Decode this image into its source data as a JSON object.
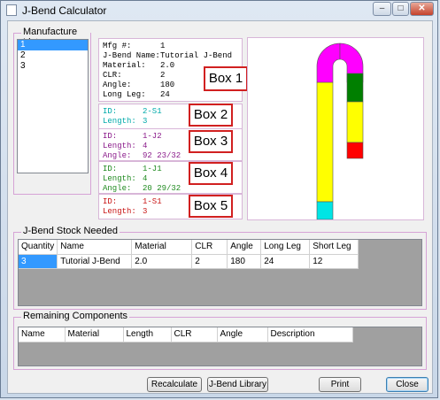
{
  "window": {
    "title": "J-Bend Calculator",
    "minimize": "–",
    "maximize": "□",
    "close": "✕"
  },
  "manufacture_list": {
    "label": "Manufacture List",
    "items": [
      "1",
      "2",
      "3"
    ],
    "selected": "1"
  },
  "info_panel": {
    "rows": [
      {
        "key": "Mfg #:",
        "value": "1"
      },
      {
        "key": "J-Bend Name:",
        "value": "Tutorial J-Bend"
      },
      {
        "key": "Material:",
        "value": "2.0"
      },
      {
        "key": "CLR:",
        "value": "2"
      },
      {
        "key": "Angle:",
        "value": "180"
      },
      {
        "key": "Long Leg:",
        "value": "24"
      }
    ],
    "box_label": "Box 1"
  },
  "component_boxes": [
    {
      "color": "#00aaaa",
      "rows": [
        {
          "key": "ID:",
          "value": "2-S1"
        },
        {
          "key": "Length:",
          "value": "3"
        }
      ],
      "box_label": "Box 2"
    },
    {
      "color": "#8a1a8a",
      "rows": [
        {
          "key": "ID:",
          "value": "1-J2"
        },
        {
          "key": "Length:",
          "value": "4"
        },
        {
          "key": "Angle:",
          "value": "92 23/32"
        }
      ],
      "box_label": "Box 3"
    },
    {
      "color": "#1f8a1f",
      "rows": [
        {
          "key": "ID:",
          "value": "1-J1"
        },
        {
          "key": "Length:",
          "value": "4"
        },
        {
          "key": "Angle:",
          "value": "20 29/32"
        }
      ],
      "box_label": "Box 4"
    },
    {
      "color": "#c81414",
      "rows": [
        {
          "key": "ID:",
          "value": "1-S1"
        },
        {
          "key": "Length:",
          "value": "3"
        }
      ],
      "box_label": "Box 5"
    }
  ],
  "preview_colors": {
    "cyan": "#00e5e5",
    "yellow": "#ffff00",
    "magenta": "#ff00ff",
    "green": "#007f00",
    "red": "#ff0000"
  },
  "stock": {
    "label": "J-Bend Stock Needed",
    "columns": [
      "Quantity",
      "Name",
      "Material",
      "CLR",
      "Angle",
      "Long Leg",
      "Short Leg"
    ],
    "rows": [
      [
        "3",
        "Tutorial J-Bend",
        "2.0",
        "2",
        "180",
        "24",
        "12"
      ]
    ]
  },
  "remaining": {
    "label": "Remaining Components",
    "columns": [
      "Name",
      "Material",
      "Length",
      "CLR",
      "Angle",
      "Description"
    ]
  },
  "buttons": {
    "recalculate": "Recalculate",
    "library": "J-Bend Library",
    "print": "Print",
    "close": "Close"
  }
}
